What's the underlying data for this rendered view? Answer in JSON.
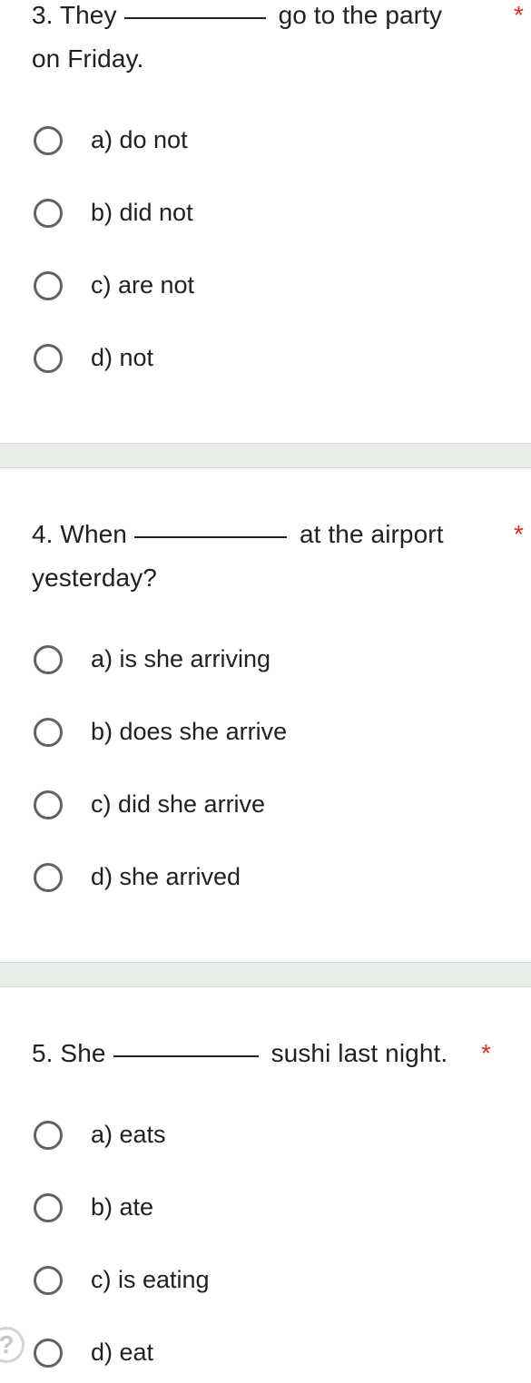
{
  "questions": [
    {
      "before": "3. They",
      "after": "go to the party",
      "line2": "on Friday.",
      "required": "*",
      "options": [
        "a) do not",
        "b) did not",
        "c) are not",
        "d) not"
      ]
    },
    {
      "before": "4. When",
      "after": "at the airport",
      "line2": "yesterday?",
      "required": "*",
      "options": [
        "a) is she arriving",
        "b) does she arrive",
        "c) did she arrive",
        "d) she arrived"
      ]
    },
    {
      "before": "5. She",
      "after": "sushi last night.",
      "line2": "",
      "required": "*",
      "options": [
        "a) eats",
        "b) ate",
        "c) is eating",
        "d) eat"
      ]
    }
  ],
  "help": {
    "glyph": "?"
  },
  "colors": {
    "required": "#d93025",
    "radio_border": "#5f6368",
    "section_gap": "#e8ede8",
    "text": "#202124"
  },
  "icons": {
    "radio": "radio-unchecked-icon",
    "help": "help-circle-icon"
  }
}
